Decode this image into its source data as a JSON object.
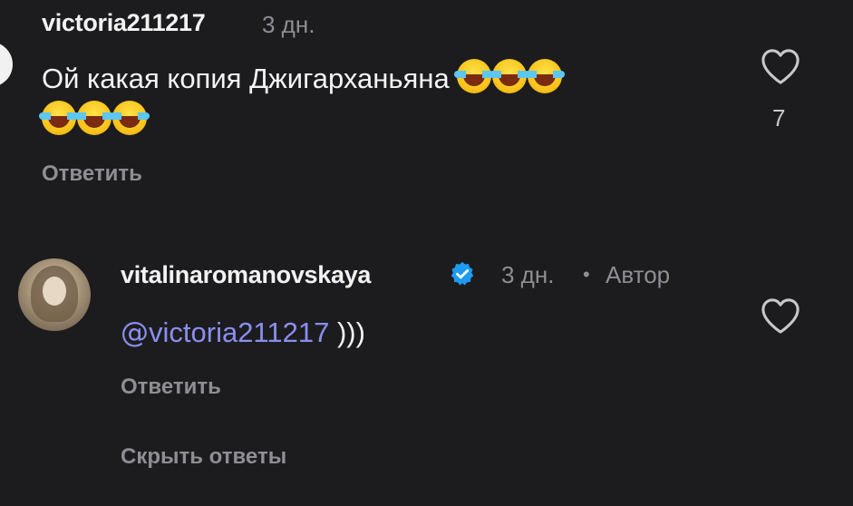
{
  "comment1": {
    "username": "victoria211217",
    "time": "3 дн.",
    "text": "Ой какая копия Джигарханьяна",
    "emoji_line1": [
      "face-with-tears-of-joy",
      "face-with-tears-of-joy",
      "face-with-tears-of-joy"
    ],
    "emoji_line2": [
      "face-with-tears-of-joy",
      "face-with-tears-of-joy",
      "face-with-tears-of-joy"
    ],
    "likes": "7",
    "reply_label": "Ответить"
  },
  "comment2": {
    "username": "vitalinaromanovskaya",
    "time": "3 дн.",
    "separator": "•",
    "author_badge": "Автор",
    "mention": "victoria211217",
    "mention_prefix": "@",
    "text": ")))",
    "reply_label": "Ответить"
  },
  "hide_replies_label": "Скрыть ответы",
  "colors": {
    "background": "#1c1c1e",
    "mention": "#8a8ff0",
    "verified": "#1d9bf0",
    "secondary_text": "#8e8e93"
  }
}
